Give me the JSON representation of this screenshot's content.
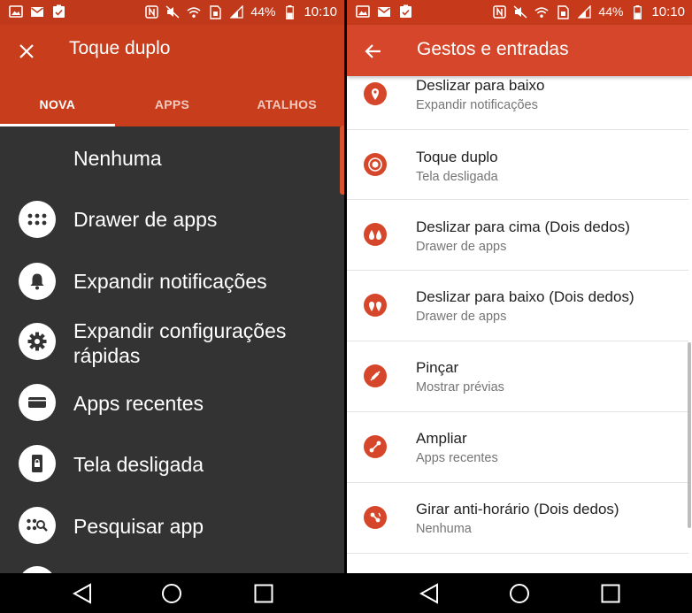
{
  "status_bar": {
    "battery": "44%",
    "time": "10:10",
    "icons_left": [
      "image-icon",
      "mail-icon",
      "clipboard-check-icon"
    ],
    "icons_right": [
      "nfc-icon",
      "mute-icon",
      "wifi-icon",
      "sim-icon",
      "signal-icon"
    ]
  },
  "left": {
    "title": "Toque duplo",
    "tabs": [
      {
        "label": "NOVA",
        "active": true
      },
      {
        "label": "APPS",
        "active": false
      },
      {
        "label": "ATALHOS",
        "active": false
      }
    ],
    "items": [
      {
        "label": "Nenhuma",
        "icon": ""
      },
      {
        "label": "Drawer de apps",
        "icon": "apps-grid-icon"
      },
      {
        "label": "Expandir notificações",
        "icon": "bell-icon"
      },
      {
        "label": "Expandir configurações rápidas",
        "icon": "gear-icon"
      },
      {
        "label": "Apps recentes",
        "icon": "recent-apps-icon"
      },
      {
        "label": "Tela desligada",
        "icon": "screen-lock-icon"
      },
      {
        "label": "Pesquisar app",
        "icon": "search-apps-icon"
      }
    ]
  },
  "right": {
    "title": "Gestos e entradas",
    "items": [
      {
        "title": "Deslizar para baixo",
        "subtitle": "Expandir notificações",
        "icon": "swipe-down-icon"
      },
      {
        "title": "Toque duplo",
        "subtitle": "Tela desligada",
        "icon": "double-tap-icon"
      },
      {
        "title": "Deslizar para cima (Dois dedos)",
        "subtitle": "Drawer de apps",
        "icon": "two-finger-swipe-up-icon"
      },
      {
        "title": "Deslizar para baixo (Dois dedos)",
        "subtitle": "Drawer de apps",
        "icon": "two-finger-swipe-down-icon"
      },
      {
        "title": "Pinçar",
        "subtitle": "Mostrar prévias",
        "icon": "pinch-icon"
      },
      {
        "title": "Ampliar",
        "subtitle": "Apps recentes",
        "icon": "spread-icon"
      },
      {
        "title": "Girar anti-horário (Dois dedos)",
        "subtitle": "Nenhuma",
        "icon": "rotate-ccw-icon"
      }
    ]
  },
  "navigation": [
    "back-icon",
    "home-icon",
    "recents-icon"
  ],
  "colors": {
    "accent": "#d6462a",
    "header_dark": "#c83e1d",
    "left_bg": "#333333"
  }
}
